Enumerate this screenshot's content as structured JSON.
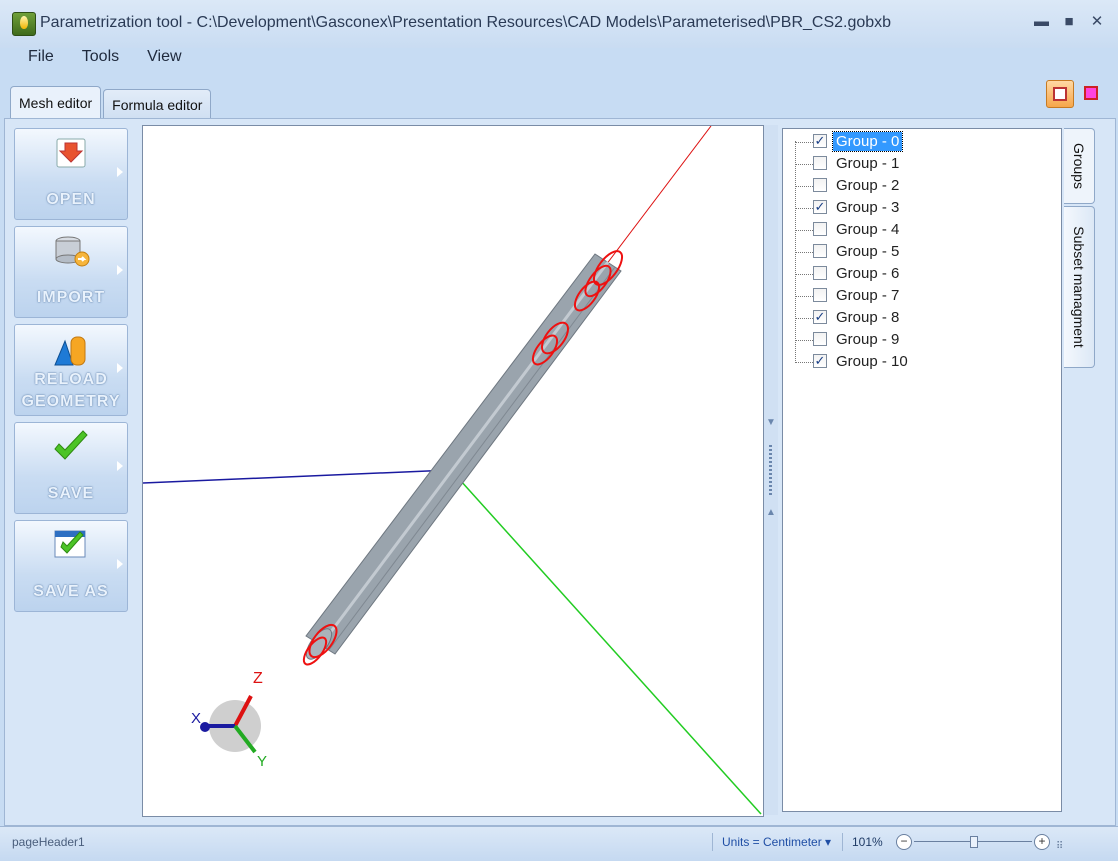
{
  "window": {
    "title": "Parametrization tool - C:\\Development\\Gasconex\\Presentation Resources\\CAD Models\\Parameterised\\PBR_CS2.gobxb",
    "controls": [
      "▬",
      "■",
      "✕"
    ]
  },
  "menu": [
    "File",
    "Tools",
    "View"
  ],
  "tabs": [
    {
      "label": "Mesh editor",
      "active": true
    },
    {
      "label": "Formula editor",
      "active": false
    }
  ],
  "toolbar": [
    {
      "label": "OPEN",
      "icon": "open-icon"
    },
    {
      "label": "IMPORT",
      "icon": "database-import-icon"
    },
    {
      "label": "RELOAD GEOMETRY",
      "icon": "shapes-icon"
    },
    {
      "label": "SAVE",
      "icon": "checkmark-icon"
    },
    {
      "label": "SAVE AS",
      "icon": "save-as-icon"
    }
  ],
  "viewport": {
    "axes": {
      "z": "Z",
      "x": "X",
      "y": "Y"
    },
    "colors": {
      "x_axis": "#1a1aa0",
      "y_axis": "#22cc22",
      "z_axis": "#dd1111",
      "mesh": "#9aa4ad",
      "highlight": "#ee1111"
    }
  },
  "groups": [
    {
      "label": "Group - 0",
      "checked": true,
      "selected": true
    },
    {
      "label": "Group - 1",
      "checked": false
    },
    {
      "label": "Group - 2",
      "checked": false
    },
    {
      "label": "Group - 3",
      "checked": true
    },
    {
      "label": "Group - 4",
      "checked": false
    },
    {
      "label": "Group - 5",
      "checked": false
    },
    {
      "label": "Group - 6",
      "checked": false
    },
    {
      "label": "Group - 7",
      "checked": false
    },
    {
      "label": "Group - 8",
      "checked": true
    },
    {
      "label": "Group - 9",
      "checked": false
    },
    {
      "label": "Group - 10",
      "checked": true
    }
  ],
  "side_tabs": [
    "Groups",
    "Subset managment"
  ],
  "status": {
    "header": "pageHeader1",
    "units": "Units = Centimeter ▾",
    "zoom": "101%",
    "zoom_fraction": 0.5
  }
}
